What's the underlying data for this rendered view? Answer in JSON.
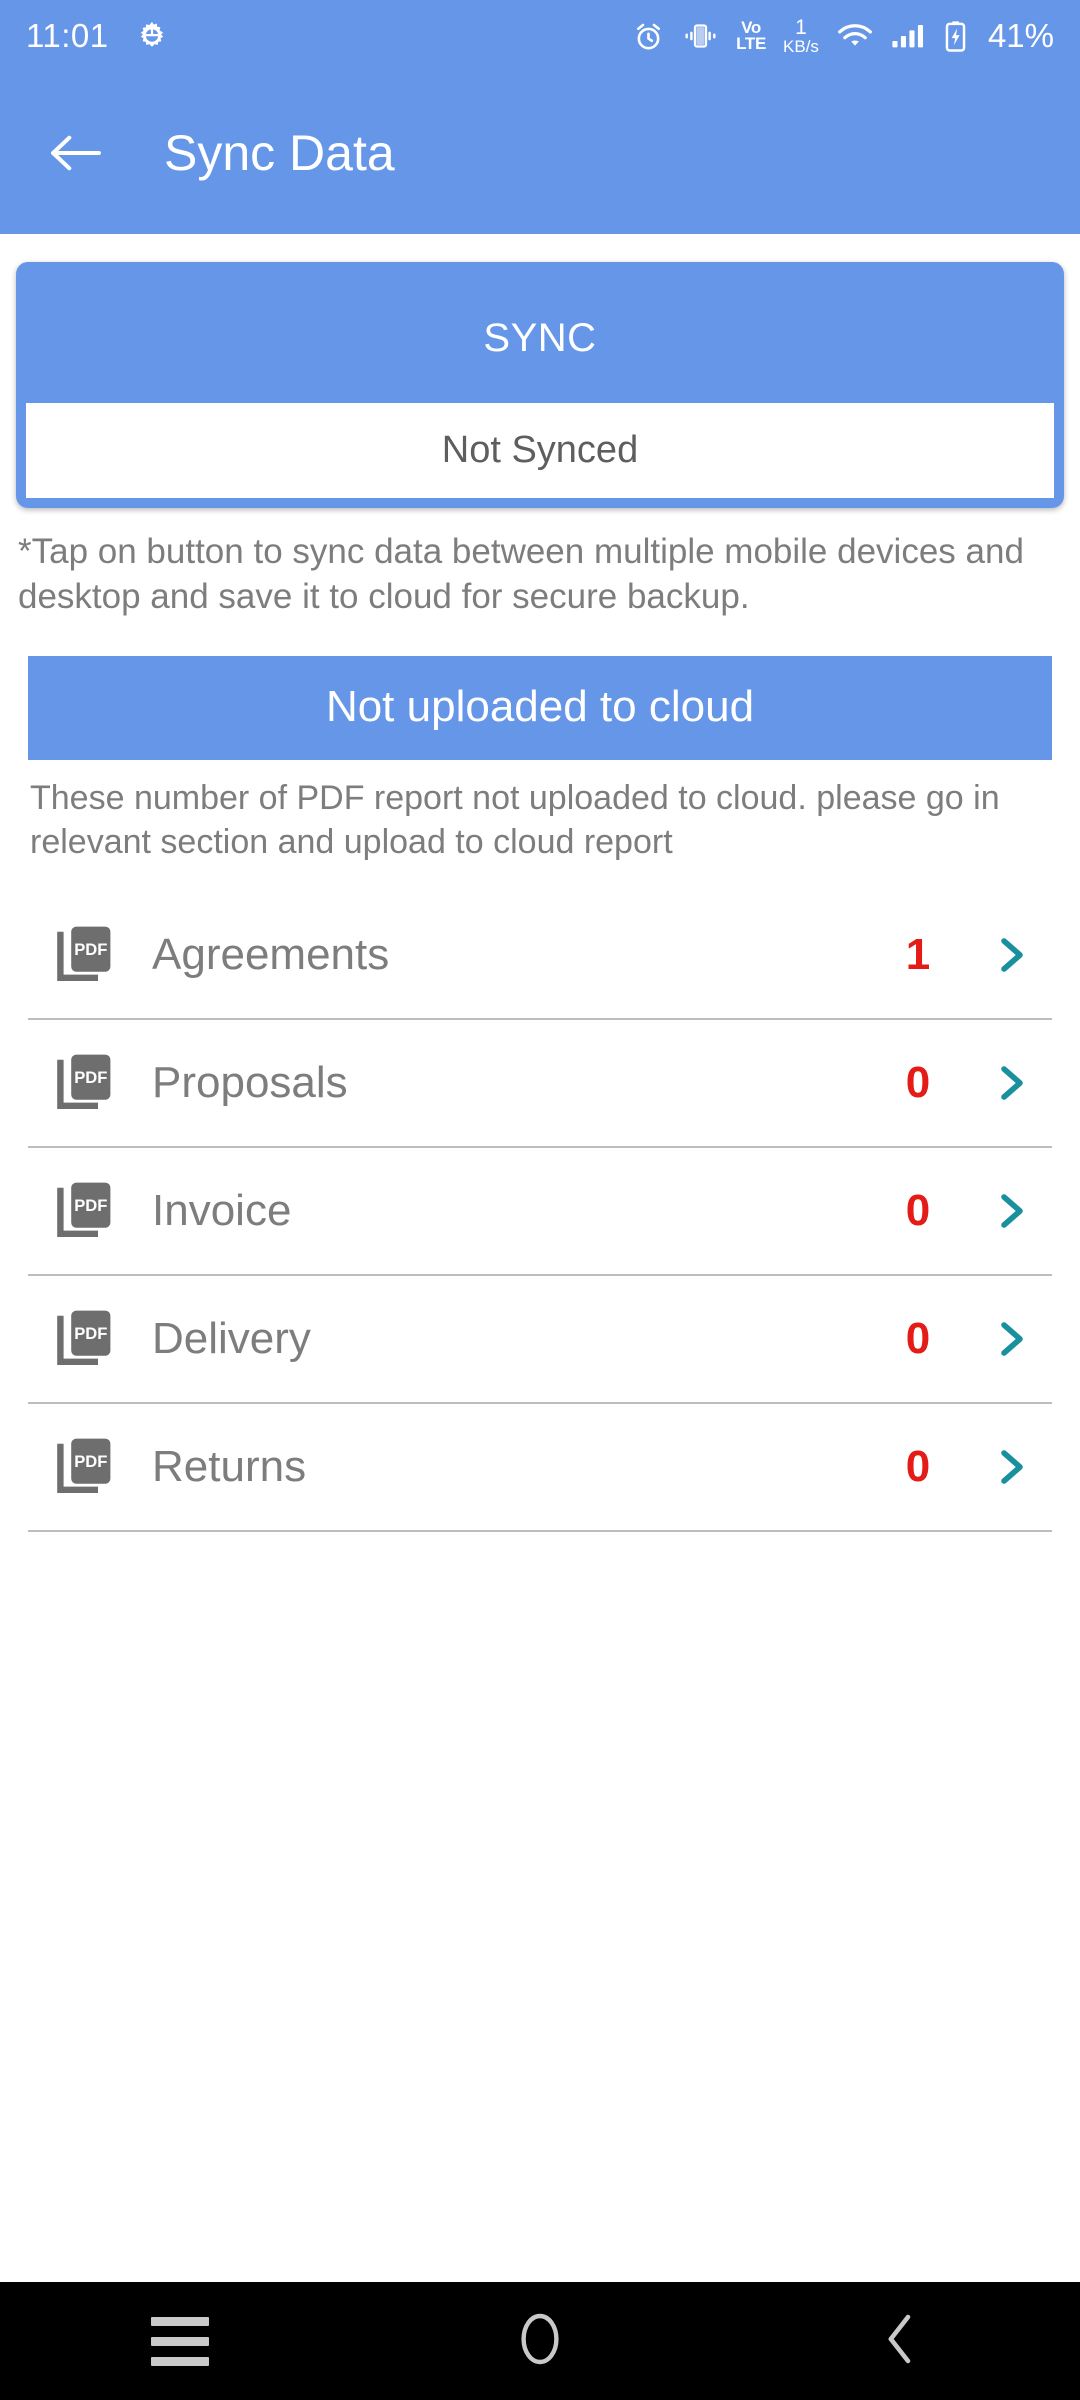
{
  "statusbar": {
    "time": "11:01",
    "settings_icon": "gear-icon",
    "alarm_icon": "alarm-clock-icon",
    "vibrate_icon": "vibrate-icon",
    "volte_line1": "VoLTE",
    "volte_top": "Vo",
    "volte_bottom": "LTE",
    "netspeed_value": "1",
    "netspeed_unit": "KB/s",
    "wifi_icon": "wifi-icon",
    "signal_icon": "cellular-signal-icon",
    "battery_icon": "battery-charging-icon",
    "battery_percent": "41%"
  },
  "appbar": {
    "back_icon": "back-arrow-icon",
    "title": "Sync Data"
  },
  "sync_card": {
    "title": "SYNC",
    "status": "Not Synced"
  },
  "note": "*Tap on button to sync data between multiple mobile devices and desktop and save it to cloud for secure backup.",
  "cloud_section": {
    "banner": "Not uploaded to cloud",
    "description": "These number of PDF report not uploaded to cloud. please go in relevant section and upload to cloud report",
    "rows": [
      {
        "icon": "pdf-icon",
        "label": "Agreements",
        "count": "1",
        "chevron": "chevron-right-icon"
      },
      {
        "icon": "pdf-icon",
        "label": "Proposals",
        "count": "0",
        "chevron": "chevron-right-icon"
      },
      {
        "icon": "pdf-icon",
        "label": "Invoice",
        "count": "0",
        "chevron": "chevron-right-icon"
      },
      {
        "icon": "pdf-icon",
        "label": "Delivery",
        "count": "0",
        "chevron": "chevron-right-icon"
      },
      {
        "icon": "pdf-icon",
        "label": "Returns",
        "count": "0",
        "chevron": "chevron-right-icon"
      }
    ]
  },
  "navbar": {
    "recents_icon": "recents-icon",
    "home_icon": "home-circle-icon",
    "back_icon": "back-chevron-icon"
  },
  "colors": {
    "brand_blue": "#6596e8",
    "count_red": "#e41b17",
    "chevron_teal": "#1a8f9e",
    "text_gray": "#7d7d7d",
    "divider_gray": "#bdbdbd",
    "navbar_black": "#000000"
  }
}
